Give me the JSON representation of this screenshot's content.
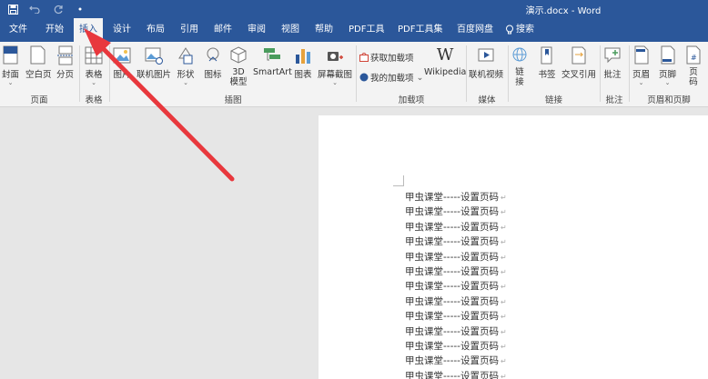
{
  "window": {
    "title": "演示.docx - Word"
  },
  "quick_access": [
    "save-icon",
    "undo-icon",
    "redo-icon",
    "customize-icon"
  ],
  "tabs": [
    {
      "label": "文件"
    },
    {
      "label": "开始"
    },
    {
      "label": "插入"
    },
    {
      "label": "设计"
    },
    {
      "label": "布局"
    },
    {
      "label": "引用"
    },
    {
      "label": "邮件"
    },
    {
      "label": "审阅"
    },
    {
      "label": "视图"
    },
    {
      "label": "帮助"
    },
    {
      "label": "PDF工具"
    },
    {
      "label": "PDF工具集"
    },
    {
      "label": "百度网盘"
    },
    {
      "label": "搜索"
    }
  ],
  "active_tab": "插入",
  "ribbon": {
    "buttons": {
      "cover": "封面",
      "blank_page": "空白页",
      "page_break": "分页",
      "table": "表格",
      "picture": "图片",
      "online_picture": "联机图片",
      "shapes": "形状",
      "icons": "图标",
      "model_3d_line1": "3D",
      "model_3d_line2": "模型",
      "smartart": "SmartArt",
      "chart": "图表",
      "screenshot": "屏幕截图",
      "get_addins": "获取加载项",
      "my_addins": "我的加载项",
      "wikipedia": "Wikipedia",
      "online_video": "联机视频",
      "link_line1": "链",
      "link_line2": "接",
      "bookmark": "书签",
      "cross_ref": "交叉引用",
      "comment": "批注",
      "header": "页眉",
      "footer": "页脚",
      "page_number_line1": "页",
      "page_number_line2": "码"
    },
    "groups": {
      "pages": "页面",
      "tables": "表格",
      "illustrations": "插图",
      "addins": "加载项",
      "media": "媒体",
      "links": "链接",
      "comments": "批注",
      "header_footer": "页眉和页脚"
    }
  },
  "document": {
    "lines": [
      "甲虫课堂-----设置页码",
      "甲虫课堂-----设置页码",
      "甲虫课堂-----设置页码",
      "甲虫课堂-----设置页码",
      "甲虫课堂-----设置页码",
      "甲虫课堂-----设置页码",
      "甲虫课堂-----设置页码",
      "甲虫课堂-----设置页码",
      "甲虫课堂-----设置页码",
      "甲虫课堂-----设置页码",
      "甲虫课堂-----设置页码",
      "甲虫课堂-----设置页码",
      "甲虫课堂-----设置页码"
    ]
  },
  "annotation": {
    "arrow_color": "#e8383d"
  },
  "colors": {
    "brand": "#2b579a",
    "ribbon_bg": "#f3f3f3",
    "canvas_bg": "#e6e6e6"
  }
}
